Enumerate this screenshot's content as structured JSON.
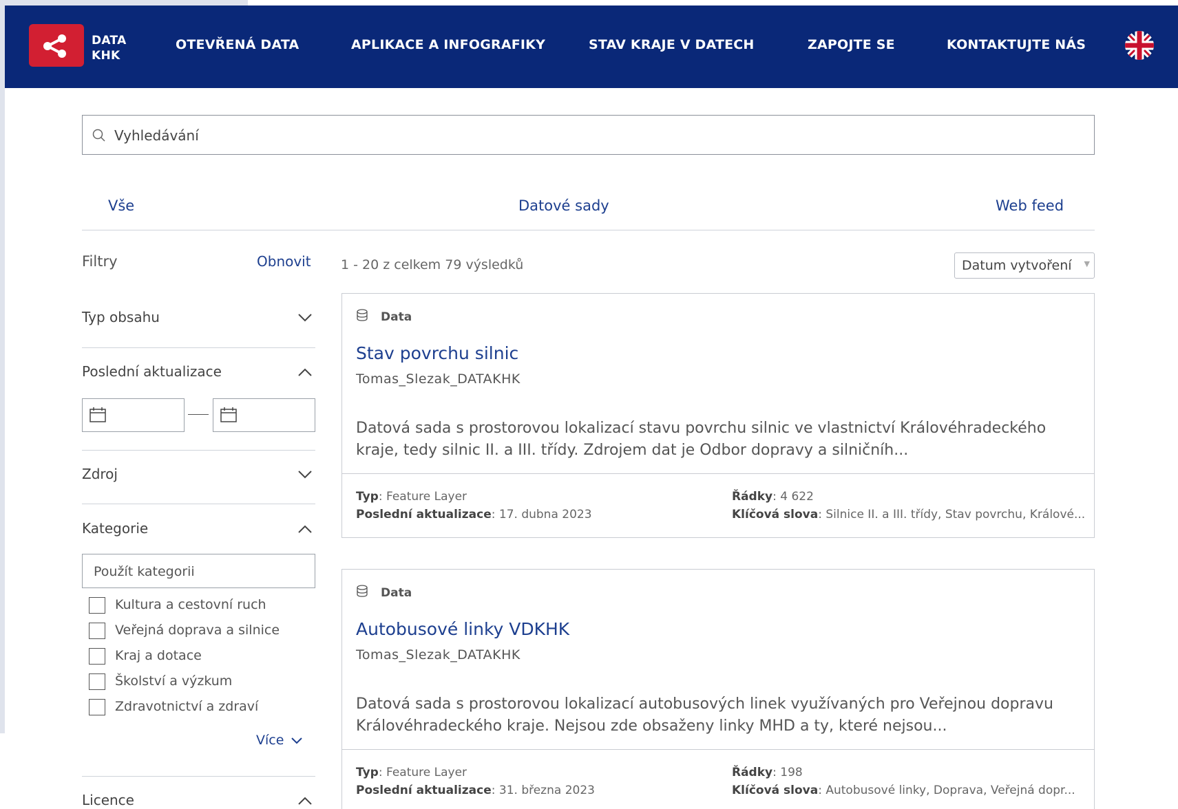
{
  "header": {
    "logo_line1": "DATA",
    "logo_line2": "KHK",
    "nav": [
      "OTEVŘENÁ DATA",
      "APLIKACE A INFOGRAFIKY",
      "STAV KRAJE V DATECH",
      "ZAPOJTE SE",
      "KONTAKTUJTE NÁS"
    ],
    "colors": {
      "bar": "#0a2878",
      "logo": "#d21f32"
    }
  },
  "search": {
    "placeholder": "Vyhledávání",
    "value": ""
  },
  "tabs": [
    "Vše",
    "Datové sady",
    "Web feed"
  ],
  "filters": {
    "title": "Filtry",
    "reset": "Obnovit",
    "facets": {
      "type": "Typ obsahu",
      "updated": "Poslední aktualizace",
      "source": "Zdroj",
      "category": "Kategorie",
      "license": "Licence"
    },
    "category_placeholder": "Použít kategorii",
    "categories": [
      "Kultura a cestovní ruch",
      "Veřejná doprava a silnice",
      "Kraj a dotace",
      "Školství a výzkum",
      "Zdravotnictví a zdraví"
    ],
    "more": "Více"
  },
  "results": {
    "count": "1 - 20 z celkem 79 výsledků",
    "sort": "Datum vytvoření",
    "labels": {
      "type": "Typ",
      "updated": "Poslední aktualizace",
      "rows": "Řádky",
      "keywords": "Klíčová slova"
    },
    "items": [
      {
        "kind": "Data",
        "title": "Stav povrchu silnic",
        "owner": "Tomas_Slezak_DATAKHK",
        "description": "Datová sada s prostorovou lokalizací stavu povrchu silnic ve vlastnictví Královéhradeckého kraje, tedy silnic II. a III. třídy. Zdrojem dat je Odbor dopravy a silničníh...",
        "type": ": Feature Layer",
        "updated": ": 17. dubna 2023",
        "rows": ": 4 622",
        "keywords": ": Silnice II. a III. třídy, Stav povrchu, Králové..."
      },
      {
        "kind": "Data",
        "title": "Autobusové linky VDKHK",
        "owner": "Tomas_Slezak_DATAKHK",
        "description": "Datová sada s prostorovou lokalizací autobusových linek využívaných pro Veřejnou dopravu Královéhradeckého kraje. Nejsou zde obsaženy linky MHD a ty, které nejsou...",
        "type": ": Feature Layer",
        "updated": ": 31. března 2023",
        "rows": ": 198",
        "keywords": ": Autobusové linky, Doprava, Veřejná dopr..."
      }
    ]
  }
}
